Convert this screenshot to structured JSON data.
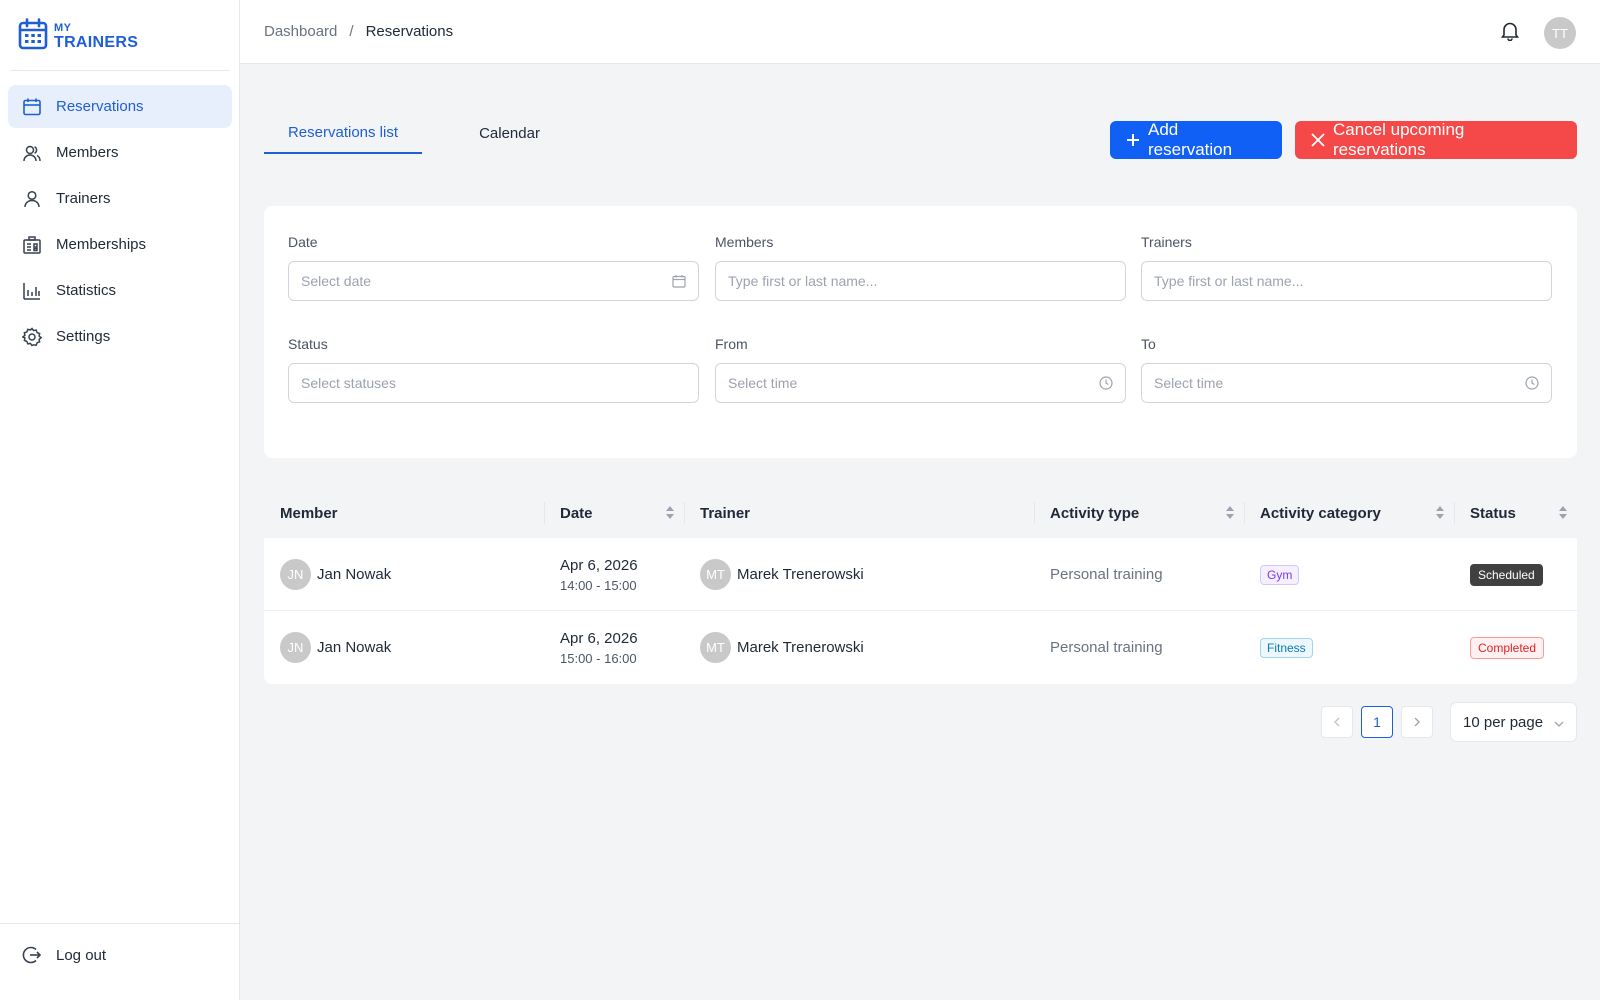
{
  "app": {
    "logo_small": "MY",
    "logo_big": "TRAINERS"
  },
  "sidebar": {
    "items": [
      {
        "label": "Reservations",
        "icon": "calendar-icon",
        "active": true
      },
      {
        "label": "Members",
        "icon": "members-icon"
      },
      {
        "label": "Trainers",
        "icon": "user-icon"
      },
      {
        "label": "Memberships",
        "icon": "memberships-icon"
      },
      {
        "label": "Statistics",
        "icon": "bar-chart-icon"
      },
      {
        "label": "Settings",
        "icon": "gear-icon"
      }
    ],
    "logout_label": "Log out"
  },
  "header": {
    "breadcrumb": [
      "Dashboard",
      "Reservations"
    ],
    "breadcrumb_sep": "/",
    "avatar_initials": "TT"
  },
  "tabs": [
    "Reservations list",
    "Calendar"
  ],
  "actions": {
    "add_label": "Add reservation",
    "cancel_label": "Cancel upcoming reservations"
  },
  "filters": {
    "date": {
      "label": "Date",
      "placeholder": "Select date"
    },
    "members": {
      "label": "Members",
      "placeholder": "Type first or last name..."
    },
    "trainers": {
      "label": "Trainers",
      "placeholder": "Type first or last name..."
    },
    "status": {
      "label": "Status",
      "placeholder": "Select statuses"
    },
    "from": {
      "label": "From",
      "placeholder": "Select time"
    },
    "to": {
      "label": "To",
      "placeholder": "Select time"
    }
  },
  "table": {
    "columns": [
      "Member",
      "Date",
      "Trainer",
      "Activity type",
      "Activity category",
      "Status"
    ],
    "rows": [
      {
        "member_initials": "JN",
        "member": "Jan Nowak",
        "date": "Apr 6, 2026",
        "time": "14:00 - 15:00",
        "trainer_initials": "MT",
        "trainer": "Marek Trenerowski",
        "activity_type": "Personal training",
        "category": "Gym",
        "status": "Scheduled"
      },
      {
        "member_initials": "JN",
        "member": "Jan Nowak",
        "date": "Apr 6, 2026",
        "time": "15:00 - 16:00",
        "trainer_initials": "MT",
        "trainer": "Marek Trenerowski",
        "activity_type": "Personal training",
        "category": "Fitness",
        "status": "Completed"
      }
    ]
  },
  "pagination": {
    "current_page": "1",
    "per_page": "10 per page"
  },
  "colors": {
    "primary": "#1160f5",
    "danger": "#f54848",
    "active_nav_bg": "#e8effc"
  }
}
